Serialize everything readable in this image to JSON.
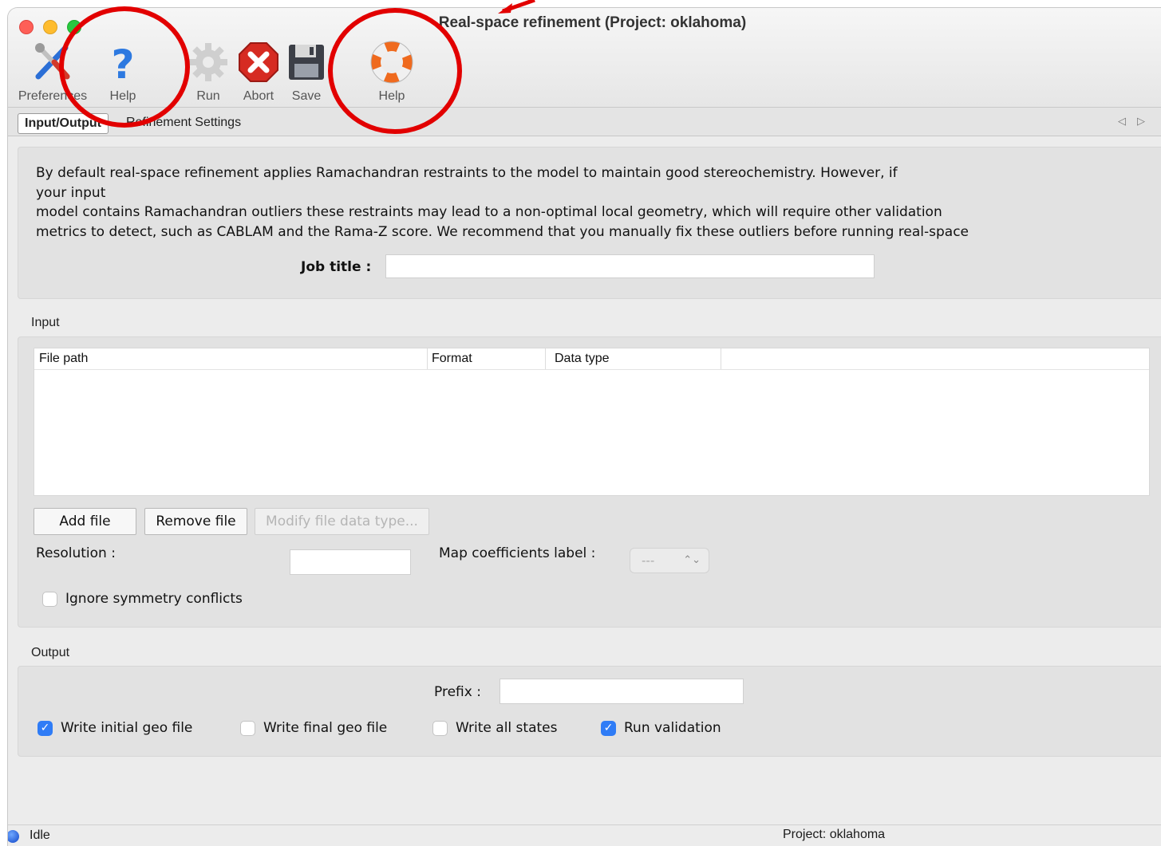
{
  "window": {
    "title": "Real-space refinement (Project: oklahoma)"
  },
  "toolbar": {
    "preferences_label": "Preferences",
    "help_label": "Help",
    "run_label": "Run",
    "abort_label": "Abort",
    "save_label": "Save",
    "help2_label": "Help"
  },
  "tabs": [
    {
      "label": "Input/Output"
    },
    {
      "label": "Refinement Settings"
    }
  ],
  "main": {
    "description_1": "By default real-space refinement applies Ramachandran restraints to the model to maintain good stereochemistry. However, if",
    "description_2": "your input",
    "description_3": "model contains Ramachandran outliers these restraints may lead to a non-optimal local geometry, which will require other validation",
    "description_4": "metrics to detect, such as CABLAM and the Rama-Z score. We recommend that you manually fix these outliers before running real-space",
    "job_title_label": "Job title :",
    "job_title_value": ""
  },
  "input": {
    "section_label": "Input",
    "columns": [
      "File path",
      "Format",
      "Data type"
    ],
    "rows": [],
    "add_file_label": "Add file",
    "remove_file_label": "Remove file",
    "modify_label": "Modify file data type...",
    "resolution_label": "Resolution :",
    "resolution_value": "",
    "map_coeff_label": "Map coefficients label :",
    "map_coeff_value": "---",
    "ignore_symmetry_label": "Ignore symmetry conflicts",
    "ignore_symmetry_checked": false
  },
  "output": {
    "section_label": "Output",
    "prefix_label": "Prefix :",
    "prefix_value": "",
    "options": [
      {
        "label": "Write initial geo file",
        "checked": true
      },
      {
        "label": "Write final geo file",
        "checked": false
      },
      {
        "label": "Write all states",
        "checked": false
      },
      {
        "label": "Run validation",
        "checked": true
      }
    ]
  },
  "status": {
    "state": "Idle",
    "project": "Project: oklahoma"
  },
  "colors": {
    "annotation_ring": "#e20000",
    "checkbox_accent": "#2f7cf6"
  }
}
